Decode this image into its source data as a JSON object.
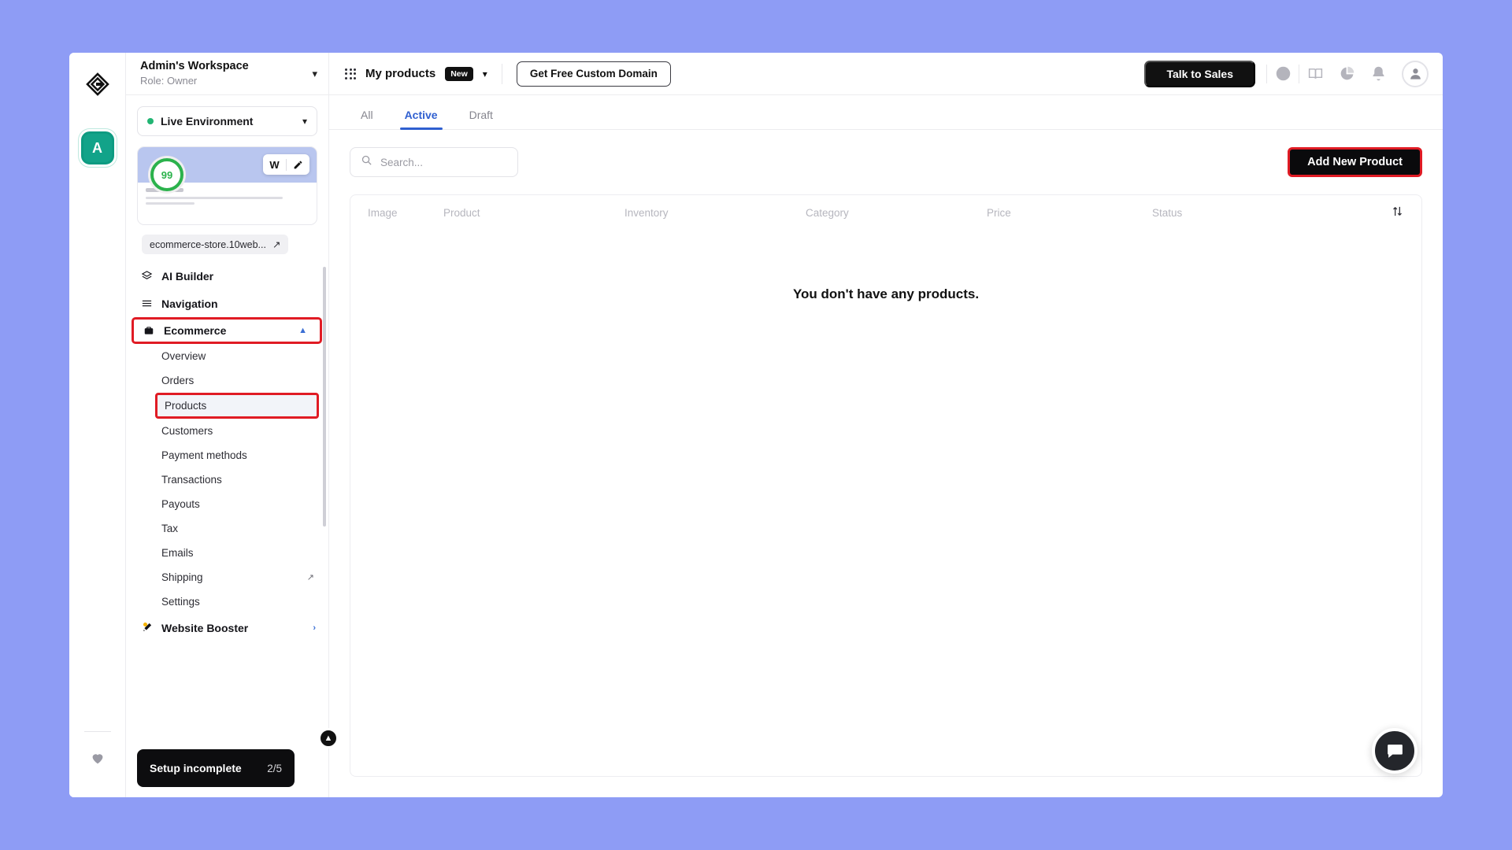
{
  "rail": {
    "logo_icon": "app-logo-icon",
    "workspace_initial": "A",
    "favorites_icon": "heart-icon"
  },
  "sidebar": {
    "workspace_name": "Admin's Workspace",
    "workspace_role": "Role: Owner",
    "workspace_chevron_icon": "chevron-down-icon",
    "environment": {
      "label": "Live Environment",
      "status_color": "#22b573",
      "chevron_icon": "chevron-down-icon"
    },
    "preview": {
      "score": "99",
      "score_color": "#2bb24c",
      "wordpress_icon": "wordpress-icon",
      "wordpress_label": "W",
      "edit_icon": "pencil-icon",
      "domain": "ecommerce-store.10web...",
      "domain_external_icon": "external-link-icon"
    },
    "nav": [
      {
        "label": "AI Builder",
        "icon": "layers-icon"
      },
      {
        "label": "Navigation",
        "icon": "menu-icon"
      },
      {
        "label": "Ecommerce",
        "icon": "briefcase-icon",
        "highlighted": true,
        "expanded": true,
        "chevron_icon": "chevron-up-icon"
      }
    ],
    "ecommerce_subitems": [
      {
        "label": "Overview"
      },
      {
        "label": "Orders"
      },
      {
        "label": "Products",
        "selected": true
      },
      {
        "label": "Customers"
      },
      {
        "label": "Payment methods"
      },
      {
        "label": "Transactions"
      },
      {
        "label": "Payouts"
      },
      {
        "label": "Tax"
      },
      {
        "label": "Emails"
      },
      {
        "label": "Shipping",
        "external_icon": "external-link-icon"
      },
      {
        "label": "Settings"
      }
    ],
    "nav_after": [
      {
        "label": "Website Booster",
        "icon": "rocket-icon",
        "has_dot": true,
        "chevron_icon": "chevron-right-icon"
      }
    ],
    "collapse_icon": "chevron-up-icon",
    "setup": {
      "label": "Setup incomplete",
      "count": "2/5"
    }
  },
  "topbar": {
    "apps_icon": "grid-apps-icon",
    "title": "My products",
    "badge": "New",
    "title_chevron_icon": "chevron-down-icon",
    "custom_domain_label": "Get Free Custom Domain",
    "talk_to_sales_label": "Talk to Sales",
    "icons": [
      {
        "name": "history-clock-icon"
      },
      {
        "name": "book-icon"
      },
      {
        "name": "pie-chart-icon"
      },
      {
        "name": "bell-icon"
      }
    ],
    "avatar_icon": "user-avatar-icon"
  },
  "tabs": [
    {
      "label": "All",
      "active": false
    },
    {
      "label": "Active",
      "active": true
    },
    {
      "label": "Draft",
      "active": false
    }
  ],
  "toolbar": {
    "search_placeholder": "Search...",
    "search_value": "",
    "search_icon": "search-icon",
    "add_product_label": "Add New Product"
  },
  "table": {
    "columns": [
      "Image",
      "Product",
      "Inventory",
      "Category",
      "Price",
      "Status"
    ],
    "sort_icon": "sort-arrows-icon",
    "rows": [],
    "empty_message": "You don't have any products."
  },
  "chat": {
    "icon": "chat-bubble-icon"
  },
  "colors": {
    "page_background": "#8e9cf5",
    "accent_blue": "#2f5fd0",
    "highlight_red": "#e01b24",
    "dark": "#111111",
    "workspace_badge": "#12a389"
  }
}
